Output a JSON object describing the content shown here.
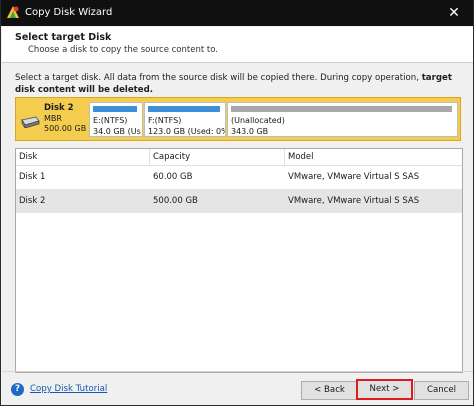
{
  "window": {
    "title": "Copy Disk Wizard",
    "close_glyph": "✕"
  },
  "header": {
    "title": "Select target Disk",
    "subtitle": "Choose a disk to copy the source content to."
  },
  "description": {
    "normal": "Select a target disk. All data from the source disk will be copied there. During copy operation, ",
    "bold": "target disk content will be deleted."
  },
  "disk_map": {
    "name": "Disk 2",
    "type": "MBR",
    "size": "500.00 GB",
    "partitions": [
      {
        "line1": "E:(NTFS)",
        "line2": "34.0 GB (Us",
        "bar_color": "#3d8fd8"
      },
      {
        "line1": "F:(NTFS)",
        "line2": "123.0 GB (Used: 0%",
        "bar_color": "#3d8fd8"
      },
      {
        "line1": "(Unallocated)",
        "line2": "343.0 GB",
        "bar_color": "#a8a8a8"
      }
    ]
  },
  "table": {
    "columns": [
      "Disk",
      "Capacity",
      "Model"
    ],
    "rows": [
      {
        "disk": "Disk 1",
        "capacity": "60.00 GB",
        "model": "VMware, VMware Virtual S SAS"
      },
      {
        "disk": "Disk 2",
        "capacity": "500.00 GB",
        "model": "VMware, VMware Virtual S SAS"
      }
    ],
    "selected_row": "Disk 2"
  },
  "footer": {
    "help_glyph": "?",
    "tutorial_link": "Copy Disk Tutorial",
    "back_label": "< Back",
    "next_label": "Next >",
    "cancel_label": "Cancel"
  }
}
